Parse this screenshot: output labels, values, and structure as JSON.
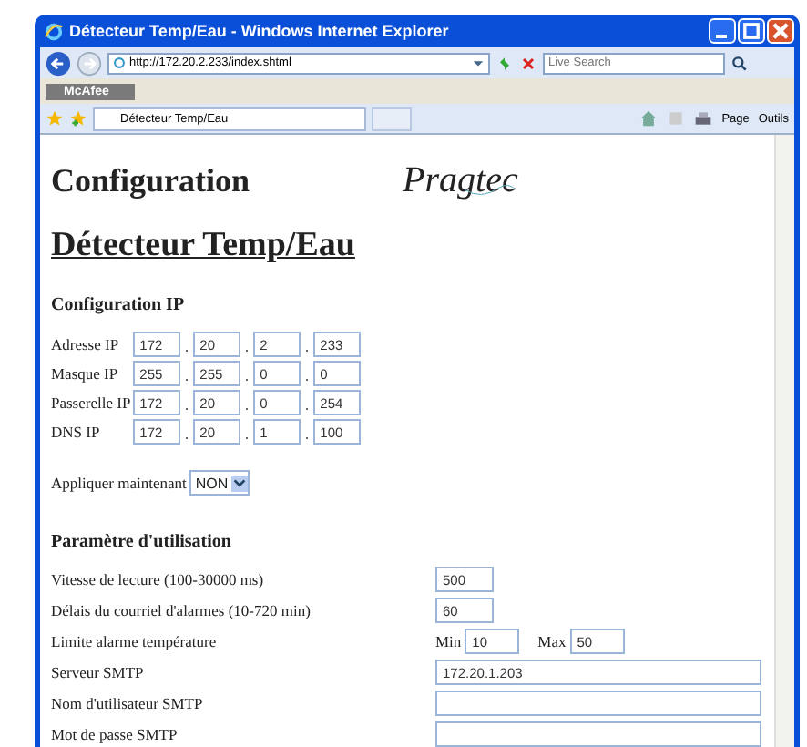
{
  "window": {
    "title": "Détecteur Temp/Eau - Windows Internet Explorer"
  },
  "address_bar": {
    "url": "http://172.20.2.233/index.shtml",
    "search_placeholder": "Live Search"
  },
  "toolbar": {
    "label": "McAfee"
  },
  "tab": {
    "title": "Détecteur Temp/Eau"
  },
  "command_bar": [
    "Page",
    "Outils"
  ],
  "page": {
    "heading": "Configuration",
    "logo": "Pragtec",
    "title": "Détecteur Temp/Eau",
    "ip_section": {
      "title": "Configuration IP",
      "rows": [
        {
          "label": "Adresse IP",
          "octets": [
            "172",
            "20",
            "2",
            "233"
          ]
        },
        {
          "label": "Masque IP",
          "octets": [
            "255",
            "255",
            "0",
            "0"
          ]
        },
        {
          "label": "Passerelle IP",
          "octets": [
            "172",
            "20",
            "0",
            "254"
          ]
        },
        {
          "label": "DNS IP",
          "octets": [
            "172",
            "20",
            "1",
            "100"
          ]
        }
      ]
    },
    "apply": {
      "label": "Appliquer maintenant",
      "value": "NON"
    },
    "usage_section": {
      "title": "Paramètre d'utilisation",
      "rows": [
        {
          "kind": "short",
          "label": "Vitesse de lecture (100-30000 ms)",
          "value": "500"
        },
        {
          "kind": "short",
          "label": "Délais du courriel d'alarmes (10-720 min)",
          "value": "60"
        },
        {
          "kind": "range",
          "label": "Limite alarme température",
          "min_label": "Min",
          "min": "10",
          "max_label": "Max",
          "max": "50"
        },
        {
          "kind": "wide",
          "label": "Serveur SMTP",
          "value": "172.20.1.203"
        },
        {
          "kind": "wide",
          "label": "Nom d'utilisateur SMTP"
        },
        {
          "kind": "wide",
          "label": "Mot de passe SMTP"
        }
      ]
    }
  }
}
